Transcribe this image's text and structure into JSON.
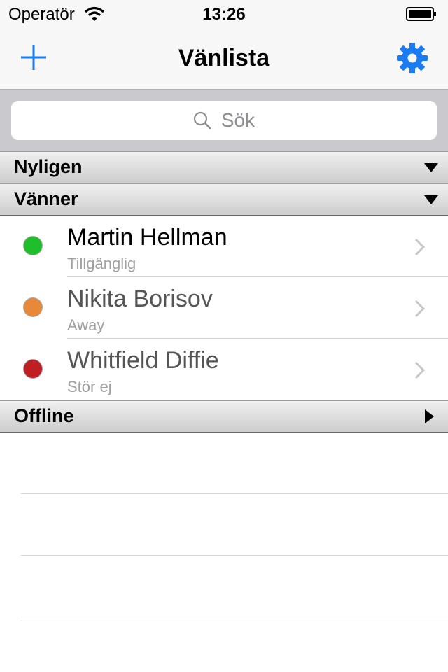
{
  "status_bar": {
    "carrier": "Operatör",
    "time": "13:26"
  },
  "nav_bar": {
    "title": "Vänlista",
    "add_icon": "plus-icon",
    "settings_icon": "gear-icon",
    "accent_color": "#1a7cf5"
  },
  "search": {
    "placeholder": "Sök",
    "icon": "magnifier-icon"
  },
  "sections": {
    "recent": {
      "label": "Nyligen",
      "expanded": true
    },
    "friends": {
      "label": "Vänner",
      "expanded": true
    },
    "offline": {
      "label": "Offline",
      "expanded": false
    }
  },
  "contacts": [
    {
      "name": "Martin Hellman",
      "status": "Tillgänglig",
      "status_color": "#1fbf2b"
    },
    {
      "name": "Nikita Borisov",
      "status": "Away",
      "status_color": "#e8893a"
    },
    {
      "name": "Whitfield Diffie",
      "status": "Stör ej",
      "status_color": "#bf1f22"
    }
  ]
}
